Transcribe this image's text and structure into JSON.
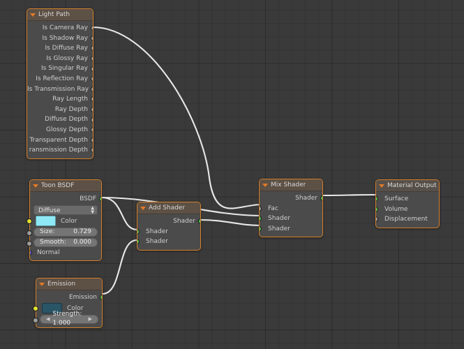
{
  "editor": {
    "name": "blender-shader-node-editor",
    "background_color": "#3a3a3a",
    "grid_color": "#333333",
    "wire_color": "#e8e8e8"
  },
  "palette": {
    "node_body": "#4b4b4b",
    "node_border": "#d4802b",
    "header_shader": "#5d5045",
    "header_output": "#57504a",
    "socket_shader": "#4cc34c",
    "socket_value": "#9d9d9d",
    "socket_color": "#e2e232",
    "socket_vector": "#5a5ad0",
    "text": "#cfcfcf"
  },
  "nodes": {
    "light_path": {
      "title": "Light Path",
      "outputs": [
        "Is Camera Ray",
        "Is Shadow Ray",
        "Is Diffuse Ray",
        "Is Glossy Ray",
        "Is Singular Ray",
        "Is Reflection Ray",
        "Is Transmission Ray",
        "Ray Length",
        "Ray Depth",
        "Diffuse Depth",
        "Glossy Depth",
        "Transparent Depth",
        "ransmission Depth"
      ]
    },
    "toon_bsdf": {
      "title": "Toon BSDF",
      "output_label": "BSDF",
      "distribution": "Diffuse",
      "color_label": "Color",
      "color_value": "#8ee8f5",
      "size_label": "Size:",
      "size_value": "0.729",
      "smooth_label": "Smooth:",
      "smooth_value": "0.000",
      "normal_label": "Normal"
    },
    "emission": {
      "title": "Emission",
      "output_label": "Emission",
      "color_label": "Color",
      "color_value": "#2a5566",
      "strength_label": "Strength: 1.000"
    },
    "add_shader": {
      "title": "Add Shader",
      "output_label": "Shader",
      "inputs": [
        "Shader",
        "Shader"
      ]
    },
    "mix_shader": {
      "title": "Mix Shader",
      "output_label": "Shader",
      "inputs": [
        "Fac",
        "Shader",
        "Shader"
      ]
    },
    "material_output": {
      "title": "Material Output",
      "inputs": [
        "Surface",
        "Volume",
        "Displacement"
      ]
    }
  },
  "links": [
    {
      "from": "light_path.Is Camera Ray",
      "to": "mix_shader.Fac"
    },
    {
      "from": "toon_bsdf.BSDF",
      "to": "mix_shader.Shader"
    },
    {
      "from": "toon_bsdf.BSDF",
      "to": "add_shader.Shader1"
    },
    {
      "from": "emission.Emission",
      "to": "add_shader.Shader2"
    },
    {
      "from": "add_shader.Shader",
      "to": "mix_shader.Shader2"
    },
    {
      "from": "mix_shader.Shader",
      "to": "material_output.Surface"
    }
  ]
}
